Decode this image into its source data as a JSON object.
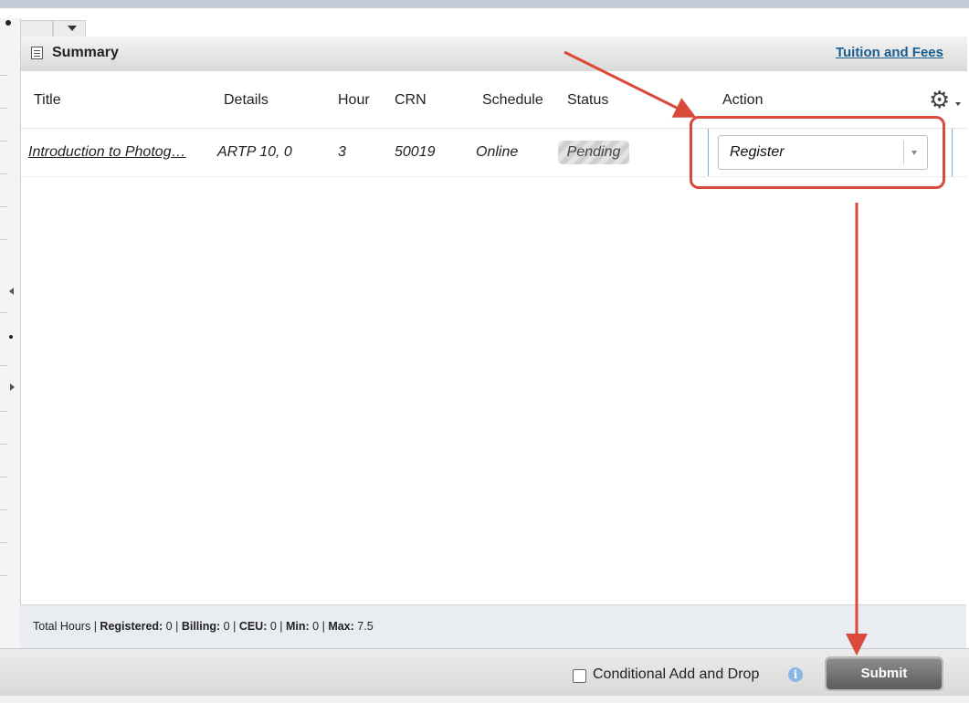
{
  "panel": {
    "title": "Summary",
    "tuition_link": "Tuition and Fees"
  },
  "table": {
    "columns": [
      "Title",
      "Details",
      "Hour",
      "CRN",
      "Schedule",
      "Status",
      "Action"
    ],
    "rows": [
      {
        "title": "Introduction to Photog…",
        "details": "ARTP 10, 0",
        "hours": "3",
        "crn": "50019",
        "schedule": "Online",
        "status": "Pending",
        "action": "Register"
      }
    ]
  },
  "footer": {
    "prefix": "Total Hours | ",
    "registered_label": "Registered:",
    "registered_value": " 0 | ",
    "billing_label": "Billing:",
    "billing_value": " 0 | ",
    "ceu_label": "CEU:",
    "ceu_value": " 0 | ",
    "min_label": "Min:",
    "min_value": " 0 | ",
    "max_label": "Max:",
    "max_value": " 7.5"
  },
  "bottom": {
    "conditional_label": "Conditional Add and Drop",
    "submit_label": "Submit"
  },
  "icons": {
    "summary": "summary-table-icon",
    "settings": "gear-icon",
    "info": "info-icon",
    "dropdown": "chevron-down-icon"
  },
  "colors": {
    "annotation": "#d94a3a",
    "link": "#1a5d8f",
    "submit": "#6f6f6f"
  }
}
